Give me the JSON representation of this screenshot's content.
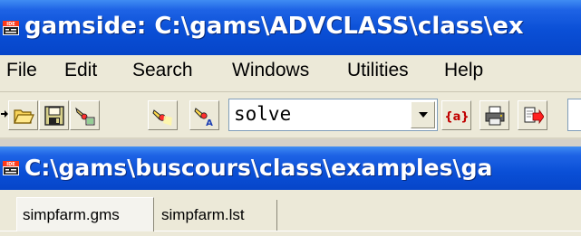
{
  "app": {
    "title": "gamside: C:\\gams\\ADVCLASS\\class\\ex",
    "icon_label": "IDE"
  },
  "menu": [
    "File",
    "Edit",
    "Search",
    "Windows",
    "Utilities",
    "Help"
  ],
  "toolbar": {
    "search_value": "solve",
    "buttons": [
      {
        "icon": "open-folder-icon"
      },
      {
        "icon": "save-disk-icon"
      },
      {
        "icon": "model-library-icon"
      },
      {
        "icon": "flashlight-icon"
      },
      {
        "icon": "flashlight-a-icon"
      },
      {
        "icon": "matching-braces-icon",
        "text": "{a}"
      },
      {
        "icon": "print-icon"
      },
      {
        "icon": "run-icon"
      }
    ]
  },
  "child_window": {
    "title": "C:\\gams\\buscours\\class\\examples\\ga",
    "icon_label": "IDE"
  },
  "tabs": [
    {
      "label": "simpfarm.gms",
      "active": true
    },
    {
      "label": "simpfarm.lst",
      "active": false
    }
  ],
  "colors": {
    "titlebar": "#0a4fd6",
    "face": "#ece9d8",
    "input_border": "#7f9db9"
  }
}
